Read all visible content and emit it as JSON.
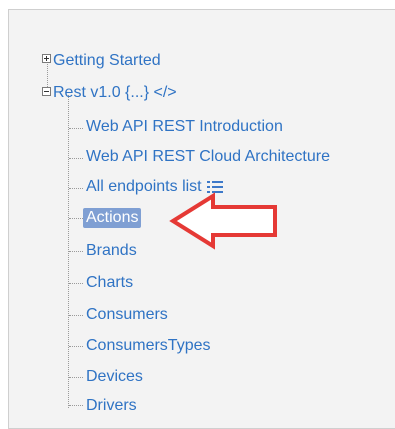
{
  "tree": {
    "getting_started": "Getting Started",
    "rest": "Rest v1.0 {...} </>",
    "children": [
      "Web API REST Introduction",
      "Web API REST Cloud Architecture",
      "All endpoints list",
      "Actions",
      "Brands",
      "Charts",
      "Consumers",
      "ConsumersTypes",
      "Devices",
      "Drivers"
    ],
    "selected_item": "Actions"
  },
  "annotation": {
    "arrow_color": "#e53935",
    "arrow_target": "Actions"
  },
  "icons": {
    "expand": "plus-box-icon",
    "collapse": "minus-box-icon",
    "list": "list-icon"
  }
}
